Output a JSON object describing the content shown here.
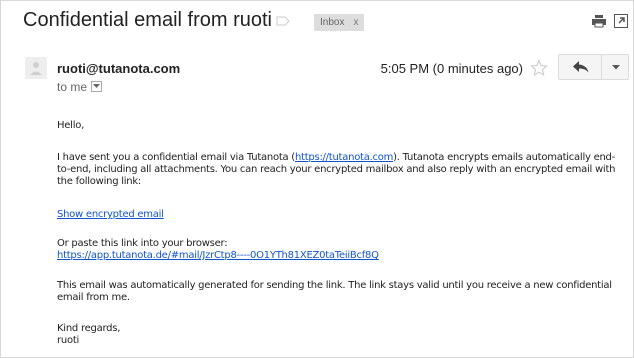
{
  "header": {
    "subject": "Confidential email from ruoti",
    "label_chip": "Inbox",
    "label_chip_close": "x"
  },
  "sender": {
    "email": "ruoti@tutanota.com",
    "recipient": "to me",
    "time": "5:05 PM (0 minutes ago)"
  },
  "icons": {
    "label": "label-outline-icon",
    "print": "printer-icon",
    "new_window": "open-in-new-window-icon",
    "avatar": "default-avatar-icon",
    "star": "star-outline-icon",
    "reply": "reply-arrow-icon",
    "more": "caret-down-icon"
  },
  "body": {
    "greeting": "Hello,",
    "intro_before_link": "I have sent you a confidential email via Tutanota (",
    "intro_link": "https://tutanota.com",
    "intro_after_link": "). Tutanota encrypts emails automatically end-to-end, including all attachments. You can reach your encrypted mailbox and also reply with an encrypted email with the following link:",
    "show_link": "Show encrypted email",
    "paste_text": "Or paste this link into your browser:",
    "paste_link": "https://app.tutanota.de/#mail/JzrCtp8----0O1YTh81XEZ0taTeiiBcf8Q",
    "auto_text": "This email was automatically generated for sending the link. The link stays valid until you receive a new confidential email from me.",
    "regards": "Kind regards,",
    "signature": "ruoti"
  },
  "colors": {
    "link": "#1155cc",
    "chip_bg": "#dddddd",
    "button_bg": "#f5f5f5"
  }
}
